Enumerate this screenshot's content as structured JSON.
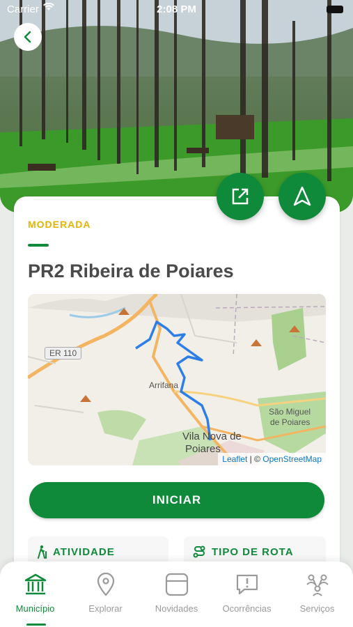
{
  "status_bar": {
    "carrier": "Carrier",
    "time": "2:08 PM"
  },
  "hero": {
    "image": "forest-picnic-park-photo"
  },
  "actions": {
    "back_icon": "chevron-left-icon",
    "open_icon": "external-link-icon",
    "navigate_icon": "navigation-arrow-icon"
  },
  "route": {
    "difficulty": "MODERADA",
    "name": "PR2 Ribeira de Poiares"
  },
  "map": {
    "labels": {
      "road": "ER 110",
      "arrifana": "Arrifana",
      "sao_miguel_1": "São Miguel",
      "sao_miguel_2": "de Poiares",
      "vila_nova_1": "Vila Nova de",
      "vila_nova_2": "Poiares"
    },
    "attribution": {
      "leaflet": "Leaflet",
      "sep": " | © ",
      "osm": "OpenStreetMap"
    },
    "route_color": "#2e7ee8"
  },
  "start_button": {
    "label": "INICIAR"
  },
  "info": {
    "activity": {
      "label": "ATIVIDADE",
      "icon": "hiking-icon"
    },
    "route_type": {
      "label": "TIPO DE ROTA",
      "icon": "route-icon"
    }
  },
  "colors": {
    "primary": "#0f8a3a",
    "difficulty": "#e6b400"
  },
  "tabbar": {
    "items": [
      {
        "label": "Município",
        "icon": "municipality-icon",
        "active": true
      },
      {
        "label": "Explorar",
        "icon": "map-pin-icon",
        "active": false
      },
      {
        "label": "Novidades",
        "icon": "news-icon",
        "active": false
      },
      {
        "label": "Ocorrências",
        "icon": "report-icon",
        "active": false
      },
      {
        "label": "Serviços",
        "icon": "services-icon",
        "active": false
      }
    ]
  }
}
